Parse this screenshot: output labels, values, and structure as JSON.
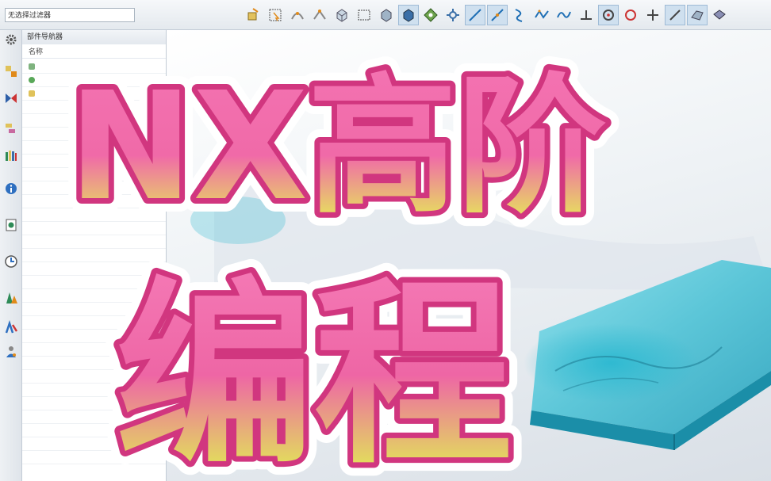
{
  "toolbar": {
    "filter_value": "无选择过滤器",
    "icons": [
      "part-icon",
      "select-box-icon",
      "snap-icon",
      "snap2-icon",
      "cube-select-icon",
      "rect-select-icon",
      "solid-icon",
      "view-cube-icon",
      "grid-snap-icon",
      "snap-point-icon",
      "line-icon",
      "line2-icon",
      "curve-icon",
      "polyline-icon",
      "spline-icon",
      "perpendicular-icon",
      "circle-center-icon",
      "circle-icon",
      "plus-icon",
      "slash-icon",
      "face-icon",
      "face2-icon"
    ]
  },
  "resource_bar": {
    "icons": [
      "gear-icon",
      "assembly-navigator-icon",
      "constraint-navigator-icon",
      "part-navigator-icon",
      "reuse-library-icon",
      "info-icon",
      "web-browser-icon",
      "history-icon",
      "system-materials-icon",
      "process-studio-icon",
      "roles-icon"
    ]
  },
  "navigator": {
    "title": "部件导航器",
    "column_name": "名称"
  },
  "overlay": {
    "line1": "NX高阶",
    "line2": "编程"
  },
  "colors": {
    "title_fill_top": "#f06aa8",
    "title_fill_bottom": "#e4ff4a",
    "title_stroke": "#d1367f",
    "title_outline": "#ffffff",
    "plate_top": "#5cc6d8",
    "plate_side": "#1b8ea8"
  }
}
